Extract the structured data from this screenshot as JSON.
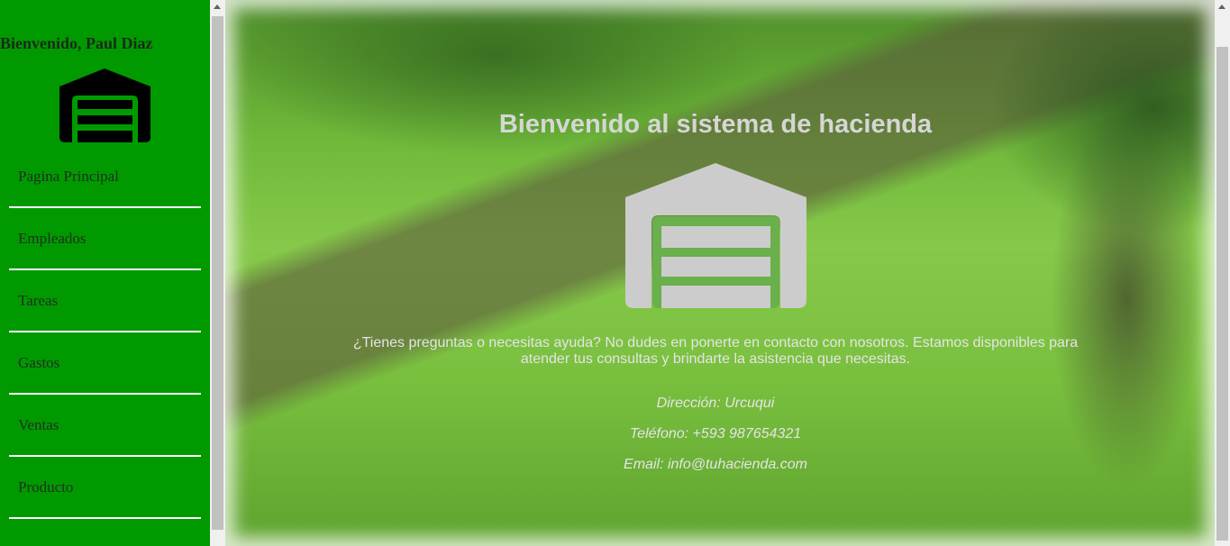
{
  "sidebar": {
    "welcome": "Bienvenido, Paul Diaz",
    "logo_icon": "warehouse-icon",
    "items": [
      {
        "label": "Pagina Principal"
      },
      {
        "label": "Empleados"
      },
      {
        "label": "Tareas"
      },
      {
        "label": "Gastos"
      },
      {
        "label": "Ventas"
      },
      {
        "label": "Producto"
      }
    ]
  },
  "main": {
    "title": "Bienvenido al sistema de hacienda",
    "logo_icon": "warehouse-icon",
    "help_text": "¿Tienes preguntas o necesitas ayuda? No dudes en ponerte en contacto con nosotros. Estamos disponibles para atender tus consultas y brindarte la asistencia que necesitas.",
    "contact": {
      "address": "Dirección: Urcuqui",
      "phone": "Teléfono: +593 987654321",
      "email": "Email: info@tuhacienda.com"
    }
  },
  "colors": {
    "sidebar_bg": "#009a00",
    "accent_green": "#6ab04c",
    "text_light": "#d6d6d6"
  }
}
